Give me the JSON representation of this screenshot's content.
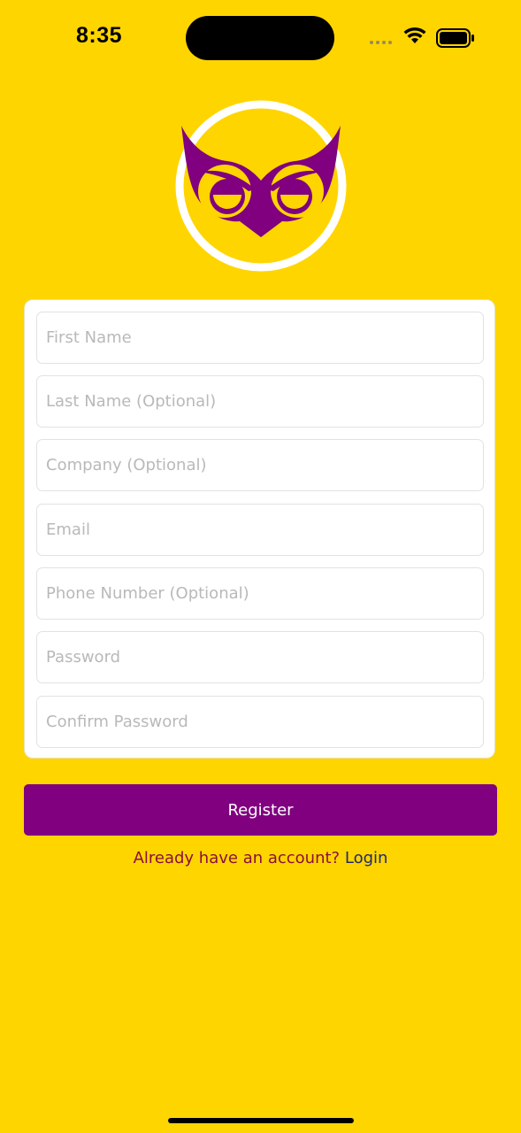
{
  "status_bar": {
    "time": "8:35",
    "icons": [
      "signal-icon",
      "wifi-icon",
      "battery-icon"
    ]
  },
  "logo": {
    "icon": "owl-logo-icon",
    "colors": {
      "ring": "#FFFFFF",
      "owl": "#800080",
      "background": "#FFD500"
    }
  },
  "form": {
    "fields": [
      {
        "placeholder": "First Name",
        "value": ""
      },
      {
        "placeholder": "Last Name (Optional)",
        "value": ""
      },
      {
        "placeholder": "Company (Optional)",
        "value": ""
      },
      {
        "placeholder": "Email",
        "value": ""
      },
      {
        "placeholder": "Phone Number (Optional)",
        "value": ""
      },
      {
        "placeholder": "Password",
        "value": ""
      },
      {
        "placeholder": "Confirm Password",
        "value": ""
      }
    ]
  },
  "actions": {
    "register_label": "Register",
    "login_prompt": "Already have an account?",
    "login_link": "Login"
  },
  "colors": {
    "background": "#FFD500",
    "accent": "#800080",
    "prompt_text": "#8A0F3C",
    "link_text": "#1F2A6B"
  }
}
